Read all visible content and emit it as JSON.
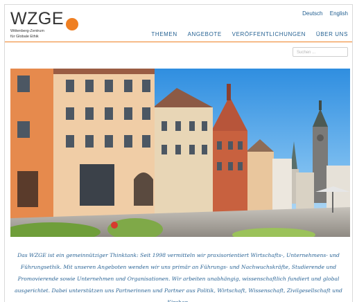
{
  "logo": {
    "word": "WZGE",
    "line1": "Wittenberg-Zentrum",
    "line2": "für Globale Ethik",
    "dot_color": "#ef7f22"
  },
  "lang": [
    "Deutsch",
    "English"
  ],
  "nav": [
    "THEMEN",
    "ANGEBOTE",
    "VERÖFFENTLICHUNGEN",
    "ÜBER UNS"
  ],
  "search": {
    "placeholder": "Suchen ..."
  },
  "intro": "Das WZGE ist ein gemeinnütziger Thinktank: Seit 1998 vermitteln wir praxisorientiert Wirtschafts-, Unternehmens- und Führungsethik. Mit unseren Angeboten wenden wir uns primär an Führungs- und Nachwuchskräfte, Studierende und Promovierende sowie Unternehmen und Organisationen. Wir arbeiten unabhängig, wissenschaftlich fundiert und global ausgerichtet. Dabei unterstützen uns Partnerinnen und Partner aus Politik, Wirtschaft, Wissenschaft, Zivilgesellschaft und Kirchen."
}
